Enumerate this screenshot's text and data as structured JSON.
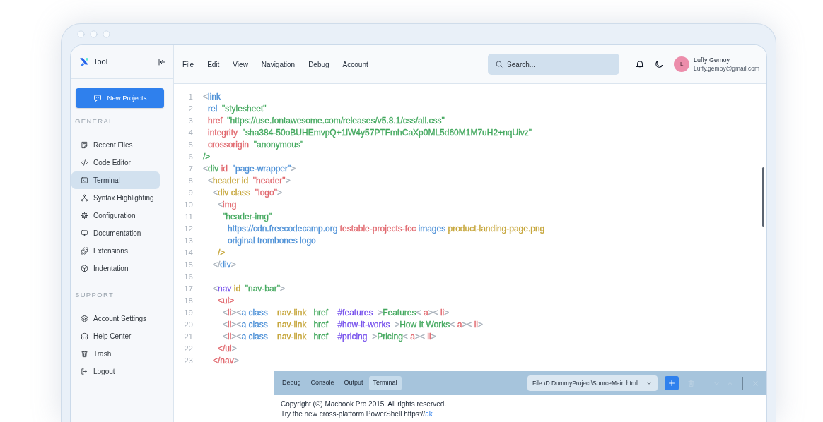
{
  "sidebar": {
    "brand": "Tool",
    "new_button": "New Projects",
    "sections": [
      {
        "title": "GENERAL",
        "items": [
          {
            "label": "Recent Files",
            "selected": false
          },
          {
            "label": "Code Editor",
            "selected": false
          },
          {
            "label": "Terminal",
            "selected": true
          },
          {
            "label": "Syntax Highlighting",
            "selected": false
          },
          {
            "label": "Configuration",
            "selected": false
          },
          {
            "label": "Documentation",
            "selected": false
          },
          {
            "label": "Extensions",
            "selected": false
          },
          {
            "label": "Indentation",
            "selected": false
          }
        ]
      },
      {
        "title": "SUPPORT",
        "items": [
          {
            "label": "Account Settings",
            "selected": false
          },
          {
            "label": "Help Center",
            "selected": false
          },
          {
            "label": "Trash",
            "selected": false
          },
          {
            "label": "Logout",
            "selected": false
          }
        ]
      }
    ]
  },
  "menu": [
    "File",
    "Edit",
    "View",
    "Navigation",
    "Debug",
    "Account"
  ],
  "search": {
    "placeholder": "Search..."
  },
  "user": {
    "initial": "L",
    "name": "Luffy Gemoy",
    "email": "Luffy.gemoy@gmail.com"
  },
  "editor": {
    "lines": [
      {
        "number": "1",
        "tokens": [
          {
            "text": "<",
            "color": "#a7b0ba"
          },
          {
            "text": "link",
            "color": "#4b8fd6"
          }
        ],
        "children": [
          {
            "number": "2",
            "tokens": [
              {
                "text": "rel",
                "color": "#4b8fd6"
              },
              {
                "text": "  \"stylesheet\"",
                "color": "#43a85e"
              }
            ]
          },
          {
            "number": "3",
            "tokens": [
              {
                "text": "href",
                "color": "#e0666c"
              },
              {
                "text": "  \"https://use.fontawesome.com/releases/v5.8.1/css/all.css\"",
                "color": "#43a85e"
              }
            ]
          },
          {
            "number": "4",
            "tokens": [
              {
                "text": "integrity",
                "color": "#e0666c"
              },
              {
                "text": "  \"sha384-50oBUHEmvpQ+1lW4y57PTFmhCaXp0ML5d60M1M7uH2+nqUivz\"",
                "color": "#43a85e"
              }
            ]
          },
          {
            "number": "5",
            "tokens": [
              {
                "text": "crossorigin",
                "color": "#e0666c"
              },
              {
                "text": "  \"anonymous\"",
                "color": "#43a85e"
              }
            ]
          }
        ]
      },
      {
        "number": "6",
        "tokens": [
          {
            "text": "/>",
            "color": "#43a85e"
          }
        ]
      },
      {
        "number": "7",
        "tokens": [
          {
            "text": "<",
            "color": "#a7b0ba"
          },
          {
            "text": "div",
            "color": "#43a85e"
          },
          {
            "text": " id",
            "color": "#e0666c"
          },
          {
            "text": "  \"page-wrapper\"",
            "color": "#4b8fd6"
          },
          {
            "text": ">",
            "color": "#a7b0ba"
          }
        ],
        "children": [
          {
            "number": "8",
            "tokens": [
              {
                "text": "<",
                "color": "#a7b0ba"
              },
              {
                "text": "header id",
                "color": "#c5a437"
              },
              {
                "text": "  \"header\"",
                "color": "#e0666c"
              },
              {
                "text": ">",
                "color": "#a7b0ba"
              }
            ],
            "children": [
              {
                "number": "9",
                "tokens": [
                  {
                    "text": "<",
                    "color": "#a7b0ba"
                  },
                  {
                    "text": "div class",
                    "color": "#c5a437"
                  },
                  {
                    "text": "  \"logo\"",
                    "color": "#e0666c"
                  },
                  {
                    "text": ">",
                    "color": "#a7b0ba"
                  }
                ],
                "children": [
                  {
                    "number": "10",
                    "tokens": [
                      {
                        "text": "<",
                        "color": "#a7b0ba"
                      },
                      {
                        "text": "img",
                        "color": "#e0666c"
                      }
                    ],
                    "children": [
                      {
                        "number": "11",
                        "tokens": [
                          {
                            "text": "\"header-img\"",
                            "color": "#43a85e"
                          }
                        ],
                        "children": [
                          {
                            "number": "12",
                            "tokens": [
                              {
                                "text": "https://cdn.freecodecamp.org",
                                "color": "#4b8fd6"
                              },
                              {
                                "text": " testable-projects-fcc",
                                "color": "#e0666c"
                              },
                              {
                                "text": " images",
                                "color": "#4b8fd6"
                              },
                              {
                                "text": " product-landing-page.png",
                                "color": "#c5a437"
                              }
                            ]
                          },
                          {
                            "number": "13",
                            "tokens": [
                              {
                                "text": "original trombones logo",
                                "color": "#4b8fd6"
                              }
                            ]
                          }
                        ]
                      }
                    ]
                  },
                  {
                    "number": "14",
                    "tokens": [
                      {
                        "text": "/>",
                        "color": "#c5a437"
                      }
                    ]
                  }
                ]
              },
              {
                "number": "15",
                "tokens": [
                  {
                    "text": "</",
                    "color": "#a7b0ba"
                  },
                  {
                    "text": "div",
                    "color": "#4b8fd6"
                  },
                  {
                    "text": ">",
                    "color": "#a7b0ba"
                  }
                ]
              },
              {
                "number": "16"
              },
              {
                "number": "17",
                "tokens": [
                  {
                    "text": "<",
                    "color": "#a7b0ba"
                  },
                  {
                    "text": "nav",
                    "color": "#7650ec"
                  },
                  {
                    "text": " id",
                    "color": "#c5a437"
                  },
                  {
                    "text": "  \"nav-bar\"",
                    "color": "#43a85e"
                  },
                  {
                    "text": ">",
                    "color": "#a7b0ba"
                  }
                ],
                "children": [
                  {
                    "number": "18",
                    "tokens": [
                      {
                        "text": "<ul>",
                        "color": "#e0666c"
                      }
                    ],
                    "children": [
                      {
                        "number": "19",
                        "tokens": [
                          {
                            "text": "<",
                            "color": "#a7b0ba"
                          },
                          {
                            "text": "li",
                            "color": "#e0666c"
                          },
                          {
                            "text": "><",
                            "color": "#a7b0ba"
                          },
                          {
                            "text": "a class",
                            "color": "#4b8fd6"
                          },
                          {
                            "text": "    nav-link",
                            "color": "#c5a437"
                          },
                          {
                            "text": "   href",
                            "color": "#43a85e"
                          },
                          {
                            "text": "    #features",
                            "color": "#7650ec"
                          },
                          {
                            "text": "  >",
                            "color": "#a7b0ba"
                          },
                          {
                            "text": "Features",
                            "color": "#43a85e"
                          },
                          {
                            "text": "<",
                            "color": "#a7b0ba"
                          },
                          {
                            "text": " a",
                            "color": "#e0666c"
                          },
                          {
                            "text": "><",
                            "color": "#a7b0ba"
                          },
                          {
                            "text": " li",
                            "color": "#e0666c"
                          },
                          {
                            "text": ">",
                            "color": "#a7b0ba"
                          }
                        ]
                      },
                      {
                        "number": "20",
                        "tokens": [
                          {
                            "text": "<",
                            "color": "#a7b0ba"
                          },
                          {
                            "text": "li",
                            "color": "#e0666c"
                          },
                          {
                            "text": "><",
                            "color": "#a7b0ba"
                          },
                          {
                            "text": "a class",
                            "color": "#4b8fd6"
                          },
                          {
                            "text": "    nav-link",
                            "color": "#c5a437"
                          },
                          {
                            "text": "   href",
                            "color": "#43a85e"
                          },
                          {
                            "text": "    #how-it-works",
                            "color": "#7650ec"
                          },
                          {
                            "text": "  >",
                            "color": "#a7b0ba"
                          },
                          {
                            "text": "How It Works",
                            "color": "#43a85e"
                          },
                          {
                            "text": "<",
                            "color": "#a7b0ba"
                          },
                          {
                            "text": " a",
                            "color": "#e0666c"
                          },
                          {
                            "text": "><",
                            "color": "#a7b0ba"
                          },
                          {
                            "text": " li",
                            "color": "#e0666c"
                          },
                          {
                            "text": ">",
                            "color": "#a7b0ba"
                          }
                        ]
                      },
                      {
                        "number": "21",
                        "tokens": [
                          {
                            "text": "<",
                            "color": "#a7b0ba"
                          },
                          {
                            "text": "li",
                            "color": "#e0666c"
                          },
                          {
                            "text": "><",
                            "color": "#a7b0ba"
                          },
                          {
                            "text": "a class",
                            "color": "#4b8fd6"
                          },
                          {
                            "text": "    nav-link",
                            "color": "#c5a437"
                          },
                          {
                            "text": "   href",
                            "color": "#43a85e"
                          },
                          {
                            "text": "    #pricing",
                            "color": "#7650ec"
                          },
                          {
                            "text": "  >",
                            "color": "#a7b0ba"
                          },
                          {
                            "text": "Pricing",
                            "color": "#43a85e"
                          },
                          {
                            "text": "<",
                            "color": "#a7b0ba"
                          },
                          {
                            "text": " a",
                            "color": "#e0666c"
                          },
                          {
                            "text": "><",
                            "color": "#a7b0ba"
                          },
                          {
                            "text": " li",
                            "color": "#e0666c"
                          },
                          {
                            "text": ">",
                            "color": "#a7b0ba"
                          }
                        ]
                      }
                    ]
                  },
                  {
                    "number": "22",
                    "tokens": [
                      {
                        "text": "</ul",
                        "color": "#e0666c"
                      },
                      {
                        "text": ">",
                        "color": "#a7b0ba"
                      }
                    ]
                  }
                ]
              },
              {
                "number": "23",
                "tokens": [
                  {
                    "text": "</nav",
                    "color": "#e0666c"
                  },
                  {
                    "text": ">",
                    "color": "#a7b0ba"
                  }
                ]
              }
            ]
          }
        ]
      }
    ]
  },
  "terminal": {
    "tabs": [
      {
        "label": "Debug",
        "selected": false
      },
      {
        "label": "Console",
        "selected": false
      },
      {
        "label": "Output",
        "selected": false
      },
      {
        "label": "Terminal",
        "selected": true
      }
    ],
    "file_select": "File:\\D:DummyProject\\SourceMain.html",
    "output": [
      {
        "text": "Copyright (©) Macbook Pro 2015. All rights reserved."
      },
      {
        "text": "Try the new cross-platform PowerShell https://",
        "link": "ak"
      }
    ]
  }
}
